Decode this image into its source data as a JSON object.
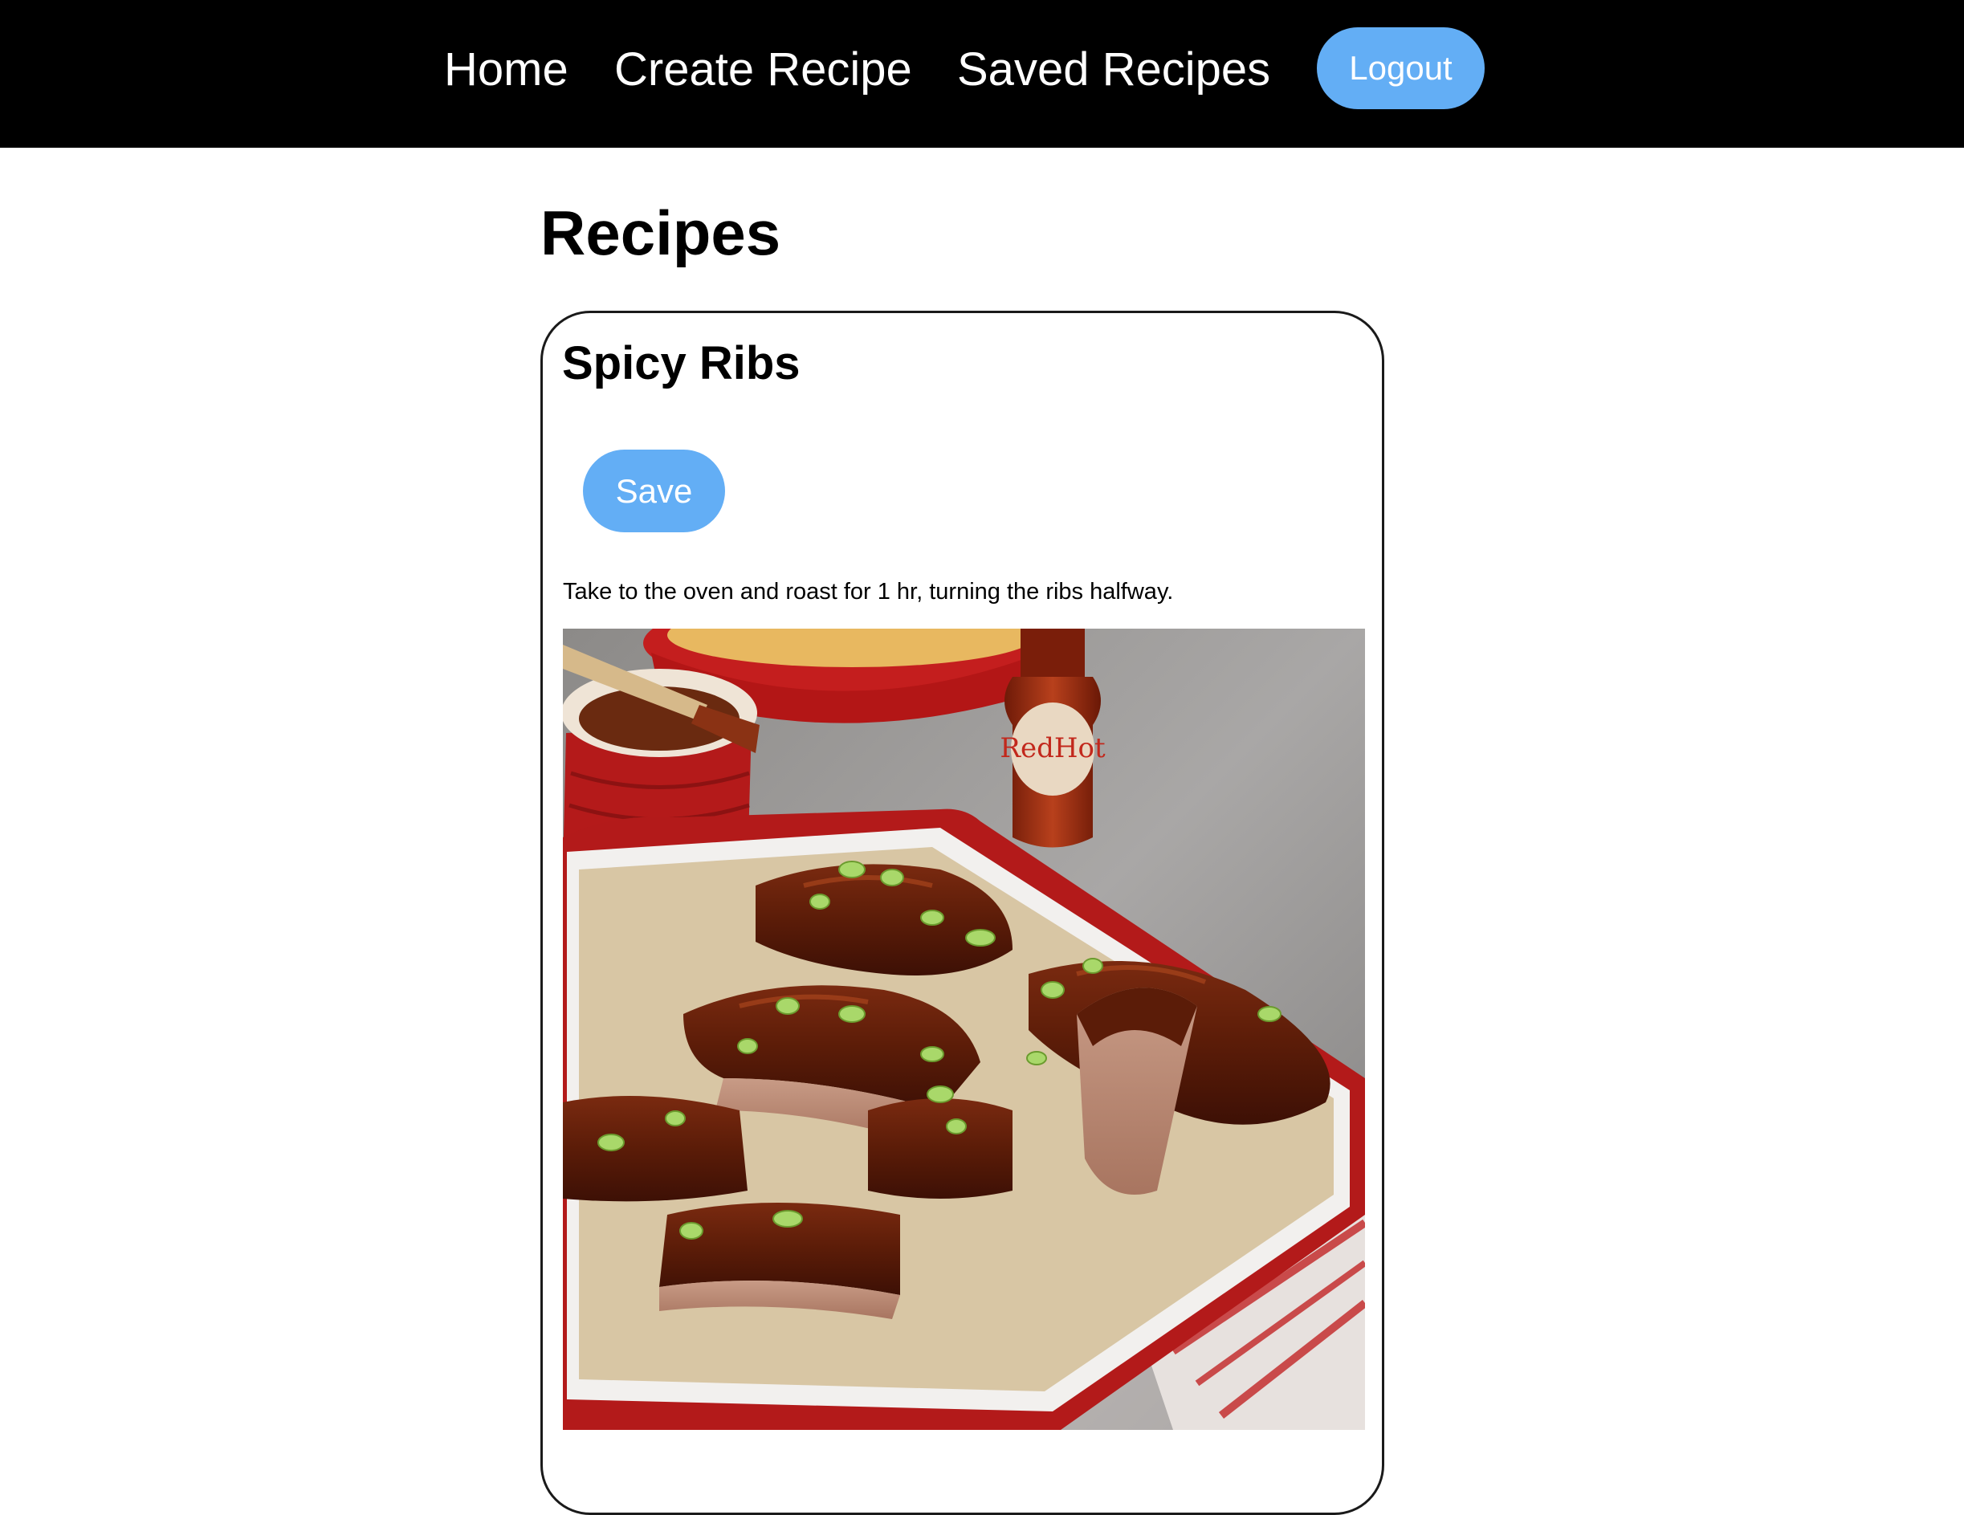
{
  "nav": {
    "items": [
      {
        "label": "Home"
      },
      {
        "label": "Create Recipe"
      },
      {
        "label": "Saved Recipes"
      }
    ],
    "logout_label": "Logout"
  },
  "page": {
    "title": "Recipes"
  },
  "recipes": [
    {
      "name": "Spicy Ribs",
      "save_label": "Save",
      "instructions": "Take to the oven and roast for 1 hr, turning the ribs halfway.",
      "image_alt": "Spicy ribs in a red baking tray with hot sauce bottle",
      "bottle_label": "RedHot"
    }
  ],
  "colors": {
    "nav_background": "#000000",
    "button_accent": "#63aef5",
    "card_border": "#1a1a1a"
  }
}
